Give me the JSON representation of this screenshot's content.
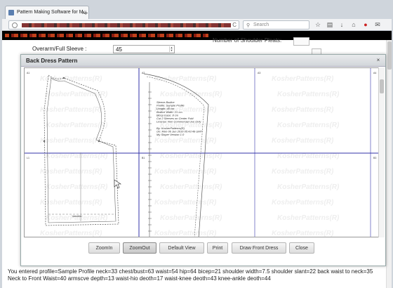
{
  "browser": {
    "tab_title": "Pattern Making Software for M...",
    "new_tab": "+",
    "tab_close": "x",
    "url_reload": "C",
    "search_placeholder": "Search",
    "toolbar_icons": [
      "star-icon",
      "reading-list-icon",
      "download-icon",
      "home-icon",
      "pocket-icon",
      "chat-icon"
    ]
  },
  "form": {
    "overarm_label": "Overarm/Full Sleeve :",
    "overarm_value": "45",
    "shoulder_pleats_label": "Number of Shoulder Pleats:"
  },
  "dialog": {
    "title": "Back Dress Pattern",
    "close": "×",
    "page_labels": [
      "A1",
      "A2",
      "A3",
      "A4",
      "L1",
      "B1",
      "",
      "B3"
    ],
    "watermark": "KosherPatterns(R)",
    "info_lines": [
      "Sleeve Bodice",
      "Profile: Sample Profile",
      "Length: 45 cm",
      "Bodice Width: 21 cm",
      "Bicep Ease: 8 cm",
      "Cut 2 Sleeves on Center Fold",
      "License: Non Commercial Use Only",
      "",
      "By: KosherPatterns(R)",
      "On: Mon 06 Jun 2016 05:43:49 GMT",
      "My Sloper Version 1.0"
    ],
    "seam_label": "waistline",
    "buttons": [
      "ZoomIn",
      "ZoomOut",
      "Default View",
      "Print",
      "Draw Front Dress",
      "Close"
    ]
  },
  "status": {
    "text": "You entered profile=Sample Profile neck=33 chest/bust=63 waist=54 hip=64 bicep=21 shoulder width=7.5 shoulder slant=22 back waist to neck=35 Neck to Front Waist=40 armscve depth=13 waist-hio deoth=17 waist-knee deoth=43 knee-ankle deoth=44"
  },
  "colors": {
    "page_grid": "#3333aa",
    "pattern_line": "#555555",
    "watermark": "#eeeeee"
  }
}
